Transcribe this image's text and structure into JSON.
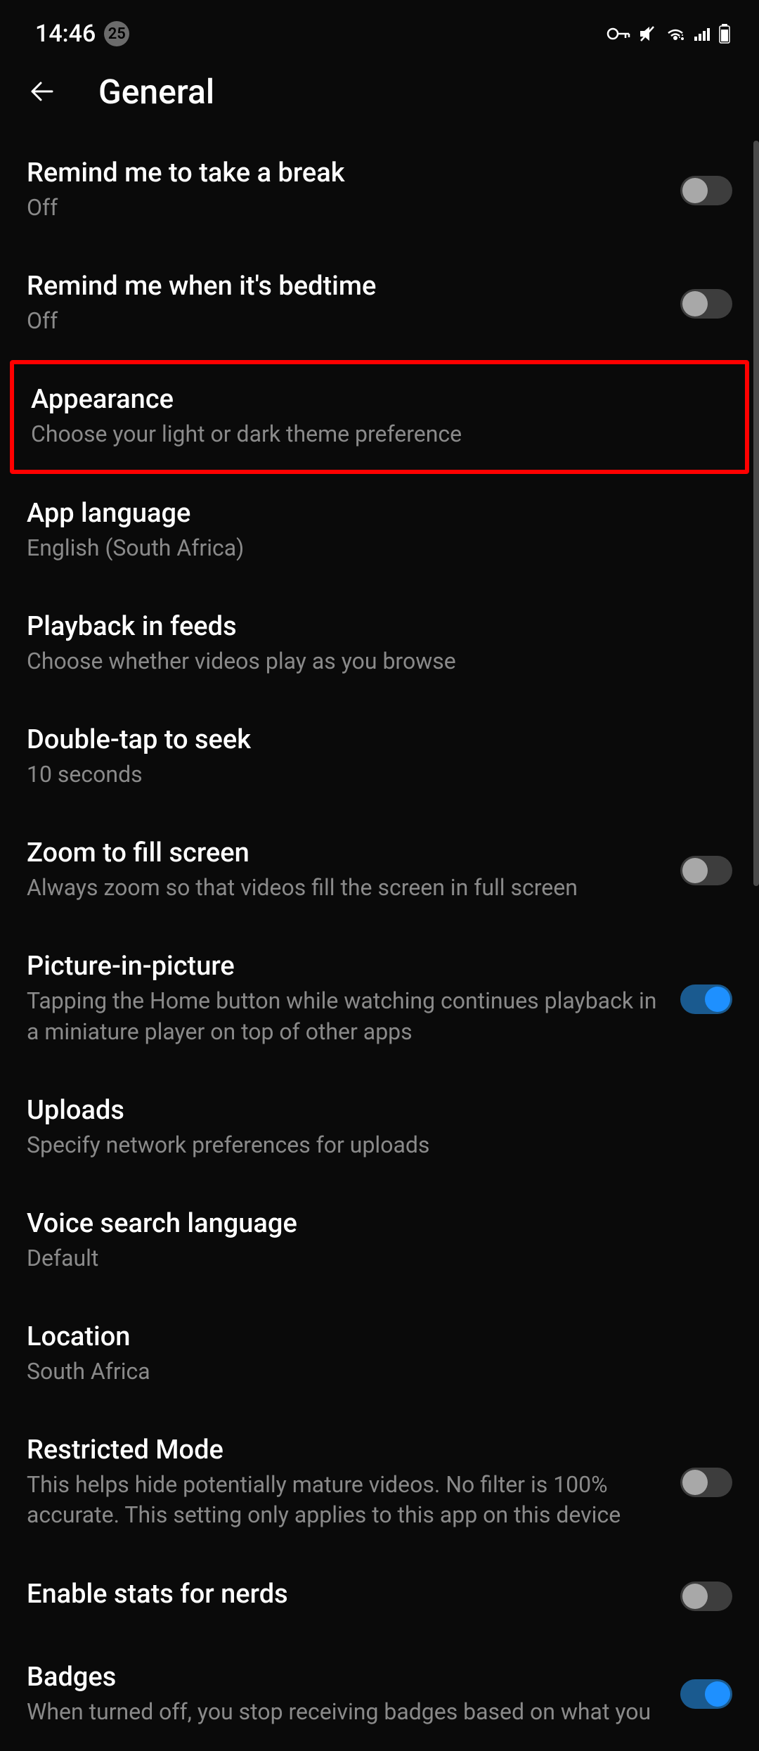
{
  "status_bar": {
    "time": "14:46",
    "badge": "25"
  },
  "header": {
    "title": "General"
  },
  "settings": [
    {
      "title": "Remind me to take a break",
      "subtitle": "Off",
      "has_toggle": true,
      "toggle_on": false
    },
    {
      "title": "Remind me when it's bedtime",
      "subtitle": "Off",
      "has_toggle": true,
      "toggle_on": false
    },
    {
      "title": "Appearance",
      "subtitle": "Choose your light or dark theme preference",
      "has_toggle": false,
      "highlighted": true
    },
    {
      "title": "App language",
      "subtitle": "English (South Africa)",
      "has_toggle": false
    },
    {
      "title": "Playback in feeds",
      "subtitle": "Choose whether videos play as you browse",
      "has_toggle": false
    },
    {
      "title": "Double-tap to seek",
      "subtitle": "10 seconds",
      "has_toggle": false
    },
    {
      "title": "Zoom to fill screen",
      "subtitle": "Always zoom so that videos fill the screen in full screen",
      "has_toggle": true,
      "toggle_on": false
    },
    {
      "title": "Picture-in-picture",
      "subtitle": "Tapping the Home button while watching continues playback in a miniature player on top of other apps",
      "has_toggle": true,
      "toggle_on": true
    },
    {
      "title": "Uploads",
      "subtitle": "Specify network preferences for uploads",
      "has_toggle": false
    },
    {
      "title": "Voice search language",
      "subtitle": "Default",
      "has_toggle": false
    },
    {
      "title": "Location",
      "subtitle": "South Africa",
      "has_toggle": false
    },
    {
      "title": "Restricted Mode",
      "subtitle": "This helps hide potentially mature videos. No filter is 100% accurate. This setting only applies to this app on this device",
      "has_toggle": true,
      "toggle_on": false
    },
    {
      "title": "Enable stats for nerds",
      "subtitle": "",
      "has_toggle": true,
      "toggle_on": false
    },
    {
      "title": "Badges",
      "subtitle": "When turned off, you stop receiving badges based on what you",
      "has_toggle": true,
      "toggle_on": true
    }
  ]
}
